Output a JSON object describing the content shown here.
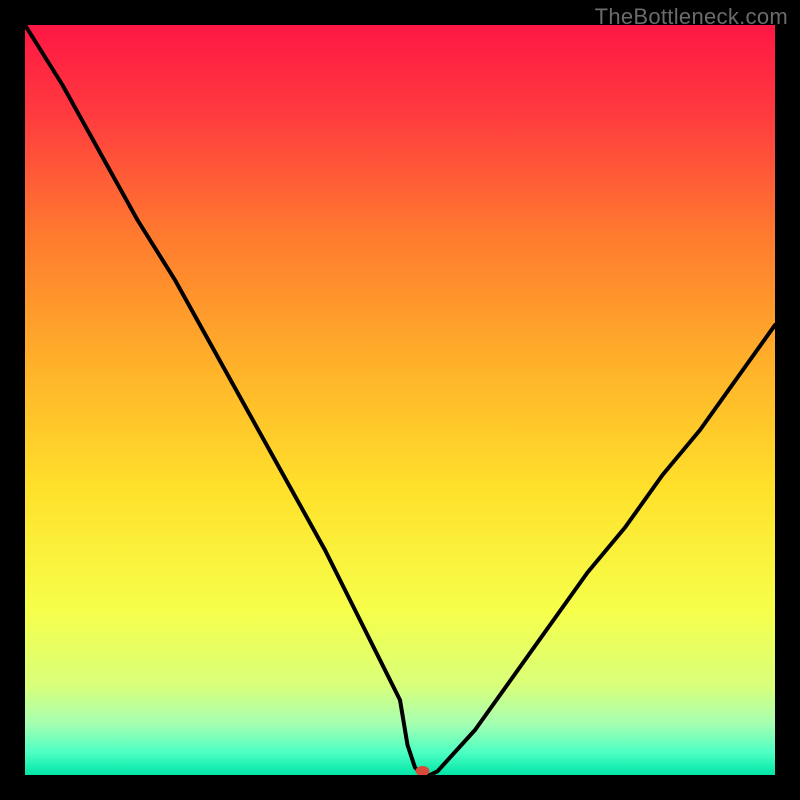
{
  "watermark": "TheBottleneck.com",
  "chart_data": {
    "type": "line",
    "title": "",
    "xlabel": "",
    "ylabel": "",
    "xlim": [
      0,
      100
    ],
    "ylim": [
      0,
      100
    ],
    "x": [
      0,
      5,
      10,
      15,
      20,
      25,
      30,
      35,
      40,
      45,
      50,
      51,
      52,
      53,
      54,
      55,
      60,
      65,
      70,
      75,
      80,
      85,
      90,
      95,
      100
    ],
    "values": [
      100,
      92,
      83,
      74,
      66,
      57,
      48,
      39,
      30,
      20,
      10,
      4,
      1,
      0,
      0,
      0.5,
      6,
      13,
      20,
      27,
      33,
      40,
      46,
      53,
      60
    ],
    "min_marker": {
      "x": 53,
      "y": 0
    },
    "gradient_stops": [
      {
        "offset": 0.0,
        "color": "#ff1744"
      },
      {
        "offset": 0.12,
        "color": "#ff3b3f"
      },
      {
        "offset": 0.28,
        "color": "#ff7a2f"
      },
      {
        "offset": 0.45,
        "color": "#ffb02a"
      },
      {
        "offset": 0.62,
        "color": "#ffe12b"
      },
      {
        "offset": 0.78,
        "color": "#f6ff4a"
      },
      {
        "offset": 0.88,
        "color": "#d9ff7a"
      },
      {
        "offset": 0.93,
        "color": "#a8ffb0"
      },
      {
        "offset": 0.97,
        "color": "#4dffc3"
      },
      {
        "offset": 1.0,
        "color": "#00e6a8"
      }
    ],
    "marker_color": "#d84a3a"
  }
}
